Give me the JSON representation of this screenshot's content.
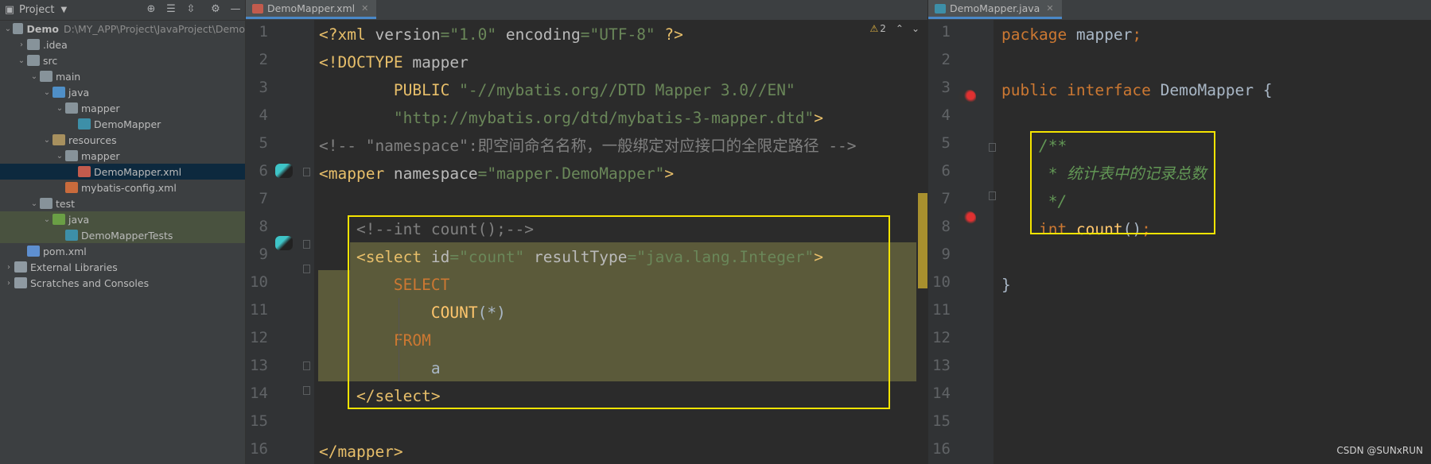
{
  "project_panel": {
    "title": "Project",
    "tree": [
      {
        "label": "Demo",
        "hint": "D:\\MY_APP\\Project\\JavaProject\\Demo",
        "level": 0,
        "arrow": "down",
        "icon": "folder-icon"
      },
      {
        "label": ".idea",
        "level": 1,
        "arrow": "right",
        "icon": "folder-icon"
      },
      {
        "label": "src",
        "level": 1,
        "arrow": "down",
        "icon": "folder-icon"
      },
      {
        "label": "main",
        "level": 2,
        "arrow": "down",
        "icon": "folder-icon"
      },
      {
        "label": "java",
        "level": 3,
        "arrow": "down",
        "icon": "source-folder-icon"
      },
      {
        "label": "mapper",
        "level": 4,
        "arrow": "down",
        "icon": "package-icon"
      },
      {
        "label": "DemoMapper",
        "level": 5,
        "arrow": "",
        "icon": "mapper-interface-icon"
      },
      {
        "label": "resources",
        "level": 3,
        "arrow": "down",
        "icon": "resources-folder-icon"
      },
      {
        "label": "mapper",
        "level": 4,
        "arrow": "down",
        "icon": "folder-icon"
      },
      {
        "label": "DemoMapper.xml",
        "level": 5,
        "arrow": "",
        "icon": "mybatis-xml-icon",
        "selected": true
      },
      {
        "label": "mybatis-config.xml",
        "level": 4,
        "arrow": "",
        "icon": "xml-file-icon"
      },
      {
        "label": "test",
        "level": 2,
        "arrow": "down",
        "icon": "folder-icon"
      },
      {
        "label": "java",
        "level": 3,
        "arrow": "down",
        "icon": "test-folder-icon",
        "highlight": true
      },
      {
        "label": "DemoMapperTests",
        "level": 4,
        "arrow": "",
        "icon": "test-class-icon",
        "highlight": true
      },
      {
        "label": "pom.xml",
        "level": 1,
        "arrow": "",
        "icon": "maven-icon"
      },
      {
        "label": "External Libraries",
        "level": 0,
        "arrow": "right",
        "icon": "libraries-icon"
      },
      {
        "label": "Scratches and Consoles",
        "level": 0,
        "arrow": "right",
        "icon": "scratches-icon"
      }
    ]
  },
  "xml_editor": {
    "tab_label": "DemoMapper.xml",
    "warning_count": "2",
    "line_numbers": [
      "1",
      "2",
      "3",
      "4",
      "5",
      "6",
      "7",
      "8",
      "9",
      "10",
      "11",
      "12",
      "13",
      "14",
      "15",
      "16"
    ]
  },
  "java_editor": {
    "tab_label": "DemoMapper.java",
    "line_numbers": [
      "1",
      "2",
      "3",
      "4",
      "5",
      "6",
      "7",
      "8",
      "9",
      "10",
      "11",
      "12",
      "13",
      "14",
      "15",
      "16"
    ]
  },
  "watermark": "CSDN @SUNxRUN",
  "colors": {
    "highlight_box": "#f5e400",
    "background": "#2b2b2b",
    "selection": "#5b5a3a"
  }
}
